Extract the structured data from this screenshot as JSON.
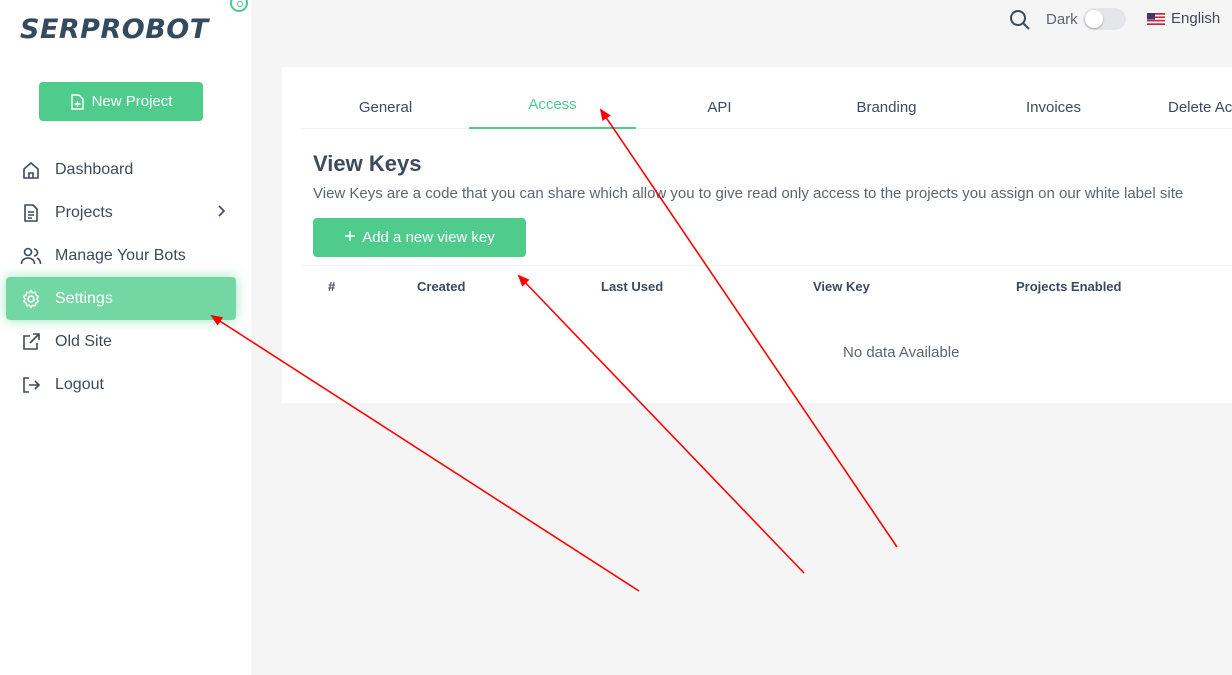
{
  "brand": {
    "logo_text": "SERPROBOT"
  },
  "sidebar": {
    "new_project_label": "New Project",
    "items": [
      {
        "label": "Dashboard",
        "icon": "home-icon"
      },
      {
        "label": "Projects",
        "icon": "document-icon"
      },
      {
        "label": "Manage Your Bots",
        "icon": "users-icon"
      },
      {
        "label": "Settings",
        "icon": "gear-icon",
        "active": true
      },
      {
        "label": "Old Site",
        "icon": "external-link-icon"
      },
      {
        "label": "Logout",
        "icon": "logout-icon"
      }
    ]
  },
  "topbar": {
    "dark_label": "Dark",
    "dark_mode_on": false,
    "language": "English"
  },
  "settings": {
    "tabs": [
      "General",
      "Access",
      "API",
      "Branding",
      "Invoices",
      "Delete Ac"
    ],
    "active_tab": "Access",
    "section_title": "View Keys",
    "section_description": "View Keys are a code that you can share which allow you to give read only access to the projects you assign on our white label site",
    "add_button_label": "Add a new view key",
    "table": {
      "columns": [
        "#",
        "Created",
        "Last Used",
        "View Key",
        "Projects Enabled"
      ],
      "rows": [],
      "empty_text": "No data Available"
    }
  },
  "colors": {
    "accent": "#4fcb8c",
    "active_nav": "#72d7a3",
    "annotation_arrow": "#ff0000"
  }
}
